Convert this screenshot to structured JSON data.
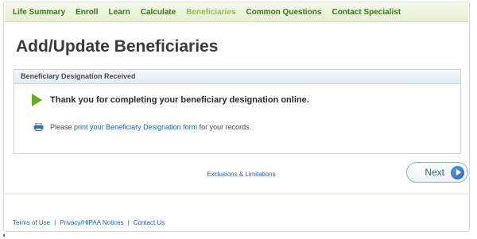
{
  "nav": {
    "items": [
      {
        "label": "Life Summary",
        "active": false
      },
      {
        "label": "Enroll",
        "active": false
      },
      {
        "label": "Learn",
        "active": false
      },
      {
        "label": "Calculate",
        "active": false
      },
      {
        "label": "Beneficiaries",
        "active": true
      },
      {
        "label": "Common Questions",
        "active": false
      },
      {
        "label": "Contact Specialist",
        "active": false
      }
    ]
  },
  "page": {
    "title": "Add/Update Beneficiaries"
  },
  "panel": {
    "header": "Beneficiary Designation Received",
    "thank_you": "Thank you for completing your beneficiary designation online.",
    "print_prefix": "Please",
    "print_link": "print your Beneficiary Designation form",
    "print_suffix": "for your records."
  },
  "actions": {
    "exclusions_link": "Exclusions & Limitations",
    "next_label": "Next"
  },
  "footer": {
    "links": [
      "Terms of Use",
      "Privacy/HIPAA Notices",
      "Contact Us"
    ],
    "separator": "|"
  },
  "icons": {
    "thank_you": "play-arrow-icon",
    "print": "printer-icon",
    "next": "arrow-circle-right-icon"
  },
  "colors": {
    "nav_link": "#2f7a10",
    "nav_active": "#8fbf3a",
    "link": "#1a5fb0",
    "accent_green": "#5fae1e",
    "button_blue": "#1f5fae"
  }
}
